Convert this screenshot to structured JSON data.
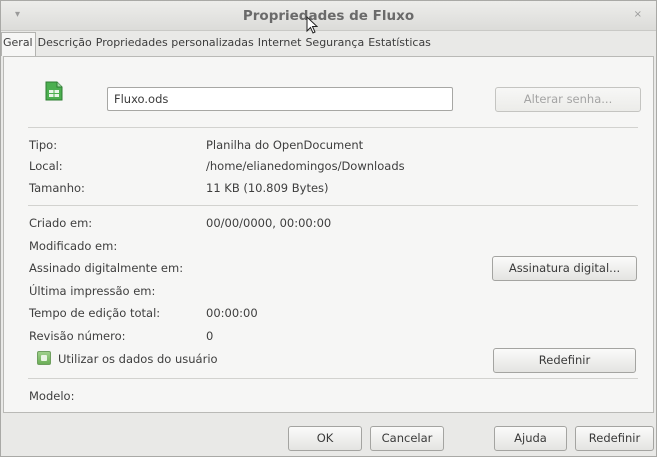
{
  "window": {
    "title": "Propriedades de Fluxo",
    "menu_glyph": "▾",
    "close_glyph": "×"
  },
  "tabs": [
    {
      "label": "Geral",
      "active": true
    },
    {
      "label": "Descrição",
      "active": false
    },
    {
      "label": "Propriedades personalizadas",
      "active": false
    },
    {
      "label": "Internet",
      "active": false
    },
    {
      "label": "Segurança",
      "active": false
    },
    {
      "label": "Estatísticas",
      "active": false
    }
  ],
  "general": {
    "icon": "spreadsheet-document-icon",
    "filename": "Fluxo.ods",
    "change_password_label": "Alterar senha...",
    "type_label": "Tipo:",
    "type_value": "Planilha do OpenDocument",
    "location_label": "Local:",
    "location_value": "/home/elianedomingos/Downloads",
    "size_label": "Tamanho:",
    "size_value": "11 KB (10.809 Bytes)",
    "created_label": "Criado em:",
    "created_value": "00/00/0000, 00:00:00",
    "modified_label": "Modificado em:",
    "signed_label": "Assinado digitalmente em:",
    "digital_signature_label": "Assinatura digital...",
    "printed_label": "Última impressão em:",
    "editing_time_label": "Tempo de edição total:",
    "editing_time_value": "00:00:00",
    "revision_label": "Revisão número:",
    "revision_value": "0",
    "use_user_data_label": "Utilizar os dados do usuário",
    "use_user_data_checked": true,
    "reset_data_label": "Redefinir",
    "template_label": "Modelo:"
  },
  "footer": {
    "ok_label": "OK",
    "cancel_label": "Cancelar",
    "help_label": "Ajuda",
    "reset_label": "Redefinir"
  },
  "colors": {
    "dialog_bg": "#e9e9e7",
    "panel_bg": "#f6f6f5",
    "ods_green": "#4caf50"
  }
}
